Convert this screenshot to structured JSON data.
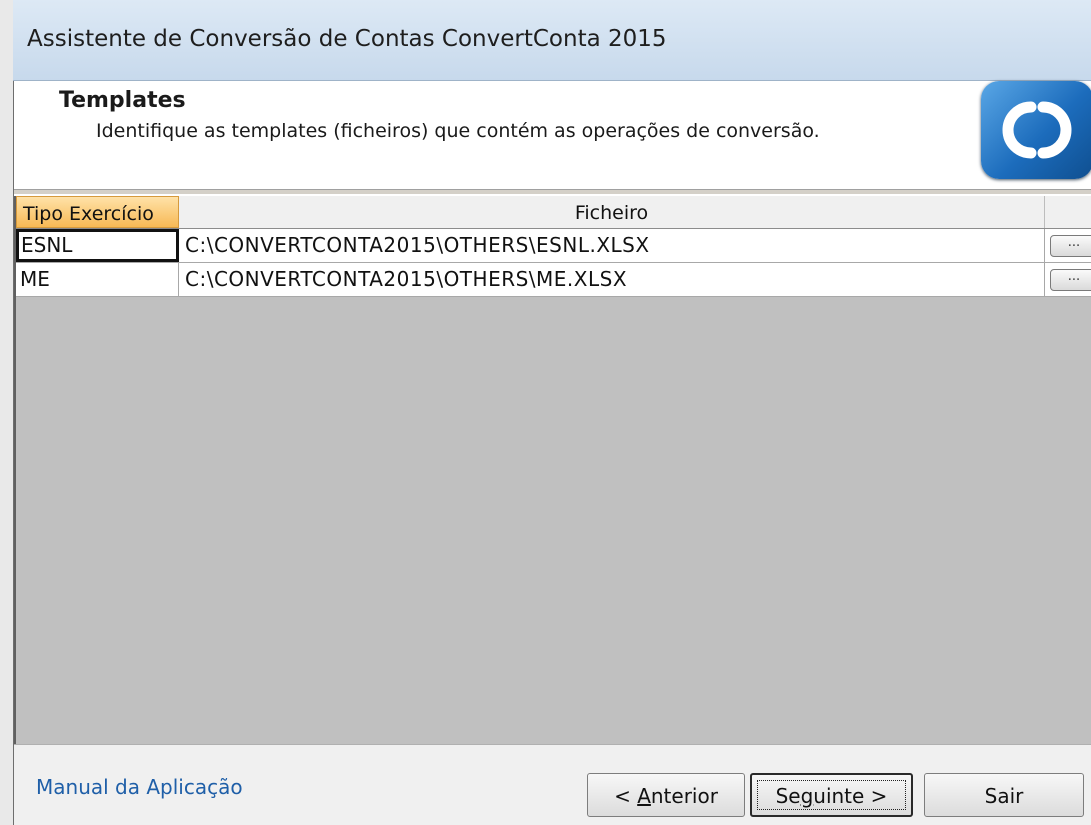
{
  "window": {
    "title": "Assistente de Conversão de Contas ConvertConta 2015"
  },
  "header": {
    "title": "Templates",
    "subtitle": "Identifique as templates (ficheiros) que contém as operações de conversão.",
    "logo_icon": "convertconta-logo-icon"
  },
  "grid": {
    "columns": [
      "Tipo Exercício",
      "Ficheiro",
      ""
    ],
    "rows": [
      {
        "tipo": "ESNL",
        "ficheiro": "C:\\CONVERTCONTA2015\\OTHERS\\ESNL.XLSX",
        "browse": "..."
      },
      {
        "tipo": "ME",
        "ficheiro": "C:\\CONVERTCONTA2015\\OTHERS\\ME.XLSX",
        "browse": "..."
      }
    ]
  },
  "footer": {
    "manual_link": "Manual da Aplicação",
    "anterior_prefix": "< ",
    "anterior_accel": "A",
    "anterior_rest": "nterior",
    "seguinte_prefix": "Se",
    "seguinte_accel": "g",
    "seguinte_rest": "uinte >",
    "sair": "Sair"
  },
  "colors": {
    "header_highlight": "#f7b955",
    "link": "#1f5fa8",
    "grid_background": "#c0c0c0"
  }
}
